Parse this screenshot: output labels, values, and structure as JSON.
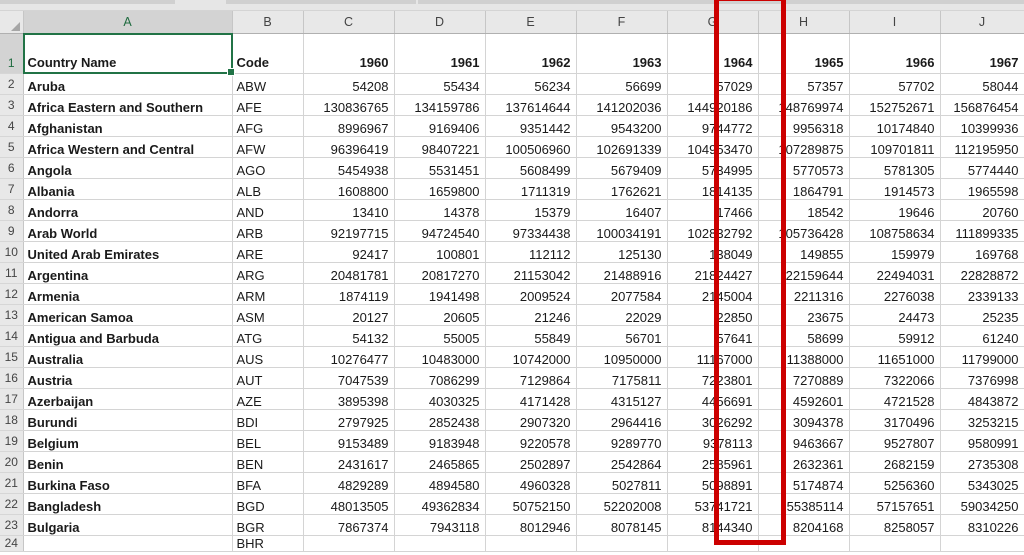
{
  "app": {
    "type": "spreadsheet",
    "selected_cell": "A1",
    "selected_column_header": "A"
  },
  "columns": [
    "A",
    "B",
    "C",
    "D",
    "E",
    "F",
    "G",
    "H",
    "I",
    "J"
  ],
  "row_numbers": [
    "1",
    "2",
    "3",
    "4",
    "5",
    "6",
    "7",
    "8",
    "9",
    "10",
    "11",
    "12",
    "13",
    "14",
    "15",
    "16",
    "17",
    "18",
    "19",
    "20",
    "21",
    "22",
    "23",
    "24"
  ],
  "header_row": {
    "A": "Country Name",
    "B": "Code",
    "C": "1960",
    "D": "1961",
    "E": "1962",
    "F": "1963",
    "G": "1964",
    "H": "1965",
    "I": "1966",
    "J": "1967"
  },
  "rows": [
    {
      "n": "2",
      "name": "Aruba",
      "code": "ABW",
      "v": [
        "54208",
        "55434",
        "56234",
        "56699",
        "57029",
        "57357",
        "57702",
        "58044"
      ]
    },
    {
      "n": "3",
      "name": "Africa Eastern and Southern",
      "code": "AFE",
      "v": [
        "130836765",
        "134159786",
        "137614644",
        "141202036",
        "144920186",
        "148769974",
        "152752671",
        "156876454"
      ]
    },
    {
      "n": "4",
      "name": "Afghanistan",
      "code": "AFG",
      "v": [
        "8996967",
        "9169406",
        "9351442",
        "9543200",
        "9744772",
        "9956318",
        "10174840",
        "10399936"
      ]
    },
    {
      "n": "5",
      "name": "Africa Western and Central",
      "code": "AFW",
      "v": [
        "96396419",
        "98407221",
        "100506960",
        "102691339",
        "104953470",
        "107289875",
        "109701811",
        "112195950"
      ]
    },
    {
      "n": "6",
      "name": "Angola",
      "code": "AGO",
      "v": [
        "5454938",
        "5531451",
        "5608499",
        "5679409",
        "5734995",
        "5770573",
        "5781305",
        "5774440"
      ]
    },
    {
      "n": "7",
      "name": "Albania",
      "code": "ALB",
      "v": [
        "1608800",
        "1659800",
        "1711319",
        "1762621",
        "1814135",
        "1864791",
        "1914573",
        "1965598"
      ]
    },
    {
      "n": "8",
      "name": "Andorra",
      "code": "AND",
      "v": [
        "13410",
        "14378",
        "15379",
        "16407",
        "17466",
        "18542",
        "19646",
        "20760"
      ]
    },
    {
      "n": "9",
      "name": "Arab World",
      "code": "ARB",
      "v": [
        "92197715",
        "94724540",
        "97334438",
        "100034191",
        "102832792",
        "105736428",
        "108758634",
        "111899335"
      ]
    },
    {
      "n": "10",
      "name": "United Arab Emirates",
      "code": "ARE",
      "v": [
        "92417",
        "100801",
        "112112",
        "125130",
        "138049",
        "149855",
        "159979",
        "169768"
      ]
    },
    {
      "n": "11",
      "name": "Argentina",
      "code": "ARG",
      "v": [
        "20481781",
        "20817270",
        "21153042",
        "21488916",
        "21824427",
        "22159644",
        "22494031",
        "22828872"
      ]
    },
    {
      "n": "12",
      "name": "Armenia",
      "code": "ARM",
      "v": [
        "1874119",
        "1941498",
        "2009524",
        "2077584",
        "2145004",
        "2211316",
        "2276038",
        "2339133"
      ]
    },
    {
      "n": "13",
      "name": "American Samoa",
      "code": "ASM",
      "v": [
        "20127",
        "20605",
        "21246",
        "22029",
        "22850",
        "23675",
        "24473",
        "25235"
      ]
    },
    {
      "n": "14",
      "name": "Antigua and Barbuda",
      "code": "ATG",
      "v": [
        "54132",
        "55005",
        "55849",
        "56701",
        "57641",
        "58699",
        "59912",
        "61240"
      ]
    },
    {
      "n": "15",
      "name": "Australia",
      "code": "AUS",
      "v": [
        "10276477",
        "10483000",
        "10742000",
        "10950000",
        "11167000",
        "11388000",
        "11651000",
        "11799000"
      ]
    },
    {
      "n": "16",
      "name": "Austria",
      "code": "AUT",
      "v": [
        "7047539",
        "7086299",
        "7129864",
        "7175811",
        "7223801",
        "7270889",
        "7322066",
        "7376998"
      ]
    },
    {
      "n": "17",
      "name": "Azerbaijan",
      "code": "AZE",
      "v": [
        "3895398",
        "4030325",
        "4171428",
        "4315127",
        "4456691",
        "4592601",
        "4721528",
        "4843872"
      ]
    },
    {
      "n": "18",
      "name": "Burundi",
      "code": "BDI",
      "v": [
        "2797925",
        "2852438",
        "2907320",
        "2964416",
        "3026292",
        "3094378",
        "3170496",
        "3253215"
      ]
    },
    {
      "n": "19",
      "name": "Belgium",
      "code": "BEL",
      "v": [
        "9153489",
        "9183948",
        "9220578",
        "9289770",
        "9378113",
        "9463667",
        "9527807",
        "9580991"
      ]
    },
    {
      "n": "20",
      "name": "Benin",
      "code": "BEN",
      "v": [
        "2431617",
        "2465865",
        "2502897",
        "2542864",
        "2585961",
        "2632361",
        "2682159",
        "2735308"
      ]
    },
    {
      "n": "21",
      "name": "Burkina Faso",
      "code": "BFA",
      "v": [
        "4829289",
        "4894580",
        "4960328",
        "5027811",
        "5098891",
        "5174874",
        "5256360",
        "5343025"
      ]
    },
    {
      "n": "22",
      "name": "Bangladesh",
      "code": "BGD",
      "v": [
        "48013505",
        "49362834",
        "50752150",
        "52202008",
        "53741721",
        "55385114",
        "57157651",
        "59034250"
      ]
    },
    {
      "n": "23",
      "name": "Bulgaria",
      "code": "BGR",
      "v": [
        "7867374",
        "7943118",
        "8012946",
        "8078145",
        "8144340",
        "8204168",
        "8258057",
        "8310226"
      ]
    },
    {
      "n": "24",
      "name": "",
      "code": "BHR",
      "v": [
        "",
        "",
        "",
        "",
        "",
        "",
        "",
        ""
      ]
    }
  ],
  "annotation": {
    "shape": "rectangle",
    "color": "#cc0000",
    "covers_column": "G"
  },
  "colors": {
    "selection_green": "#217346",
    "header_gray": "#e8e8e8",
    "gridline": "#d4d4d4",
    "annotation_red": "#cc0000"
  }
}
